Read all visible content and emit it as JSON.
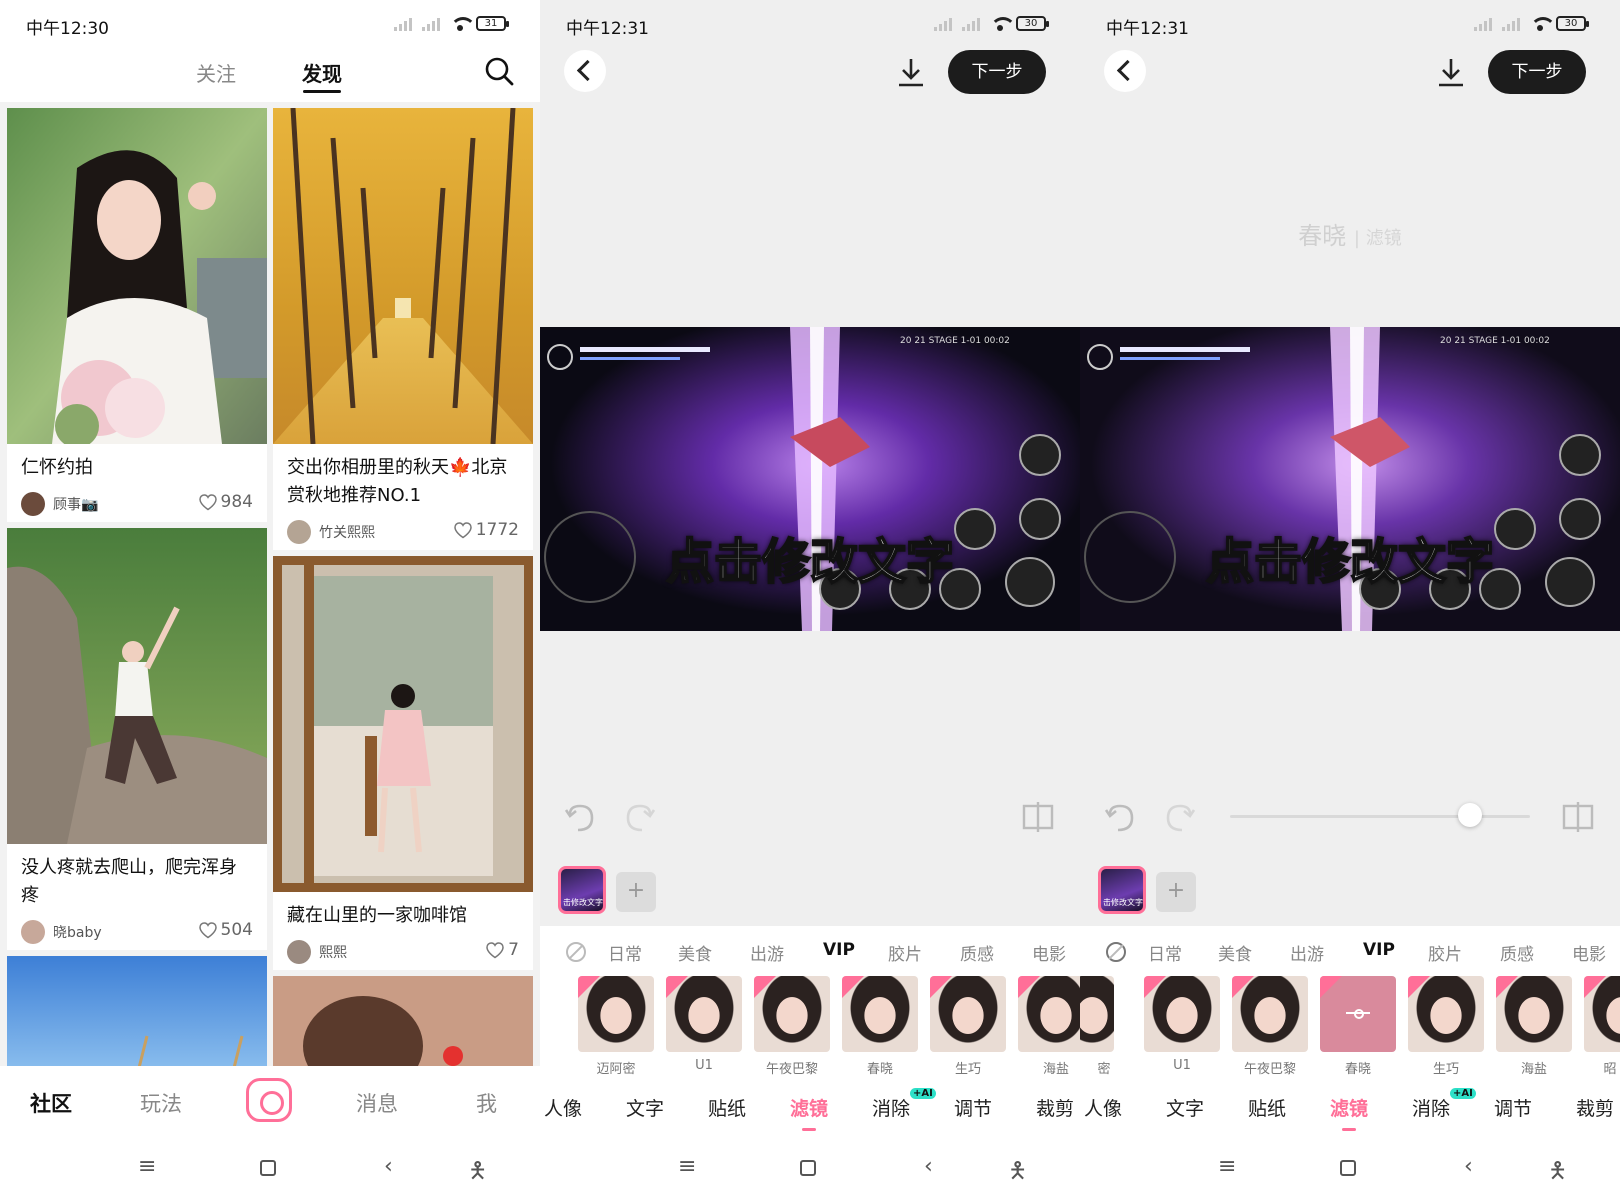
{
  "status": {
    "p1_time": "中午12:30",
    "p2_time": "中午12:31",
    "p3_time": "中午12:31",
    "p1_battery": "31",
    "p2_battery": "30",
    "p3_battery": "30"
  },
  "community": {
    "tabs": [
      "关注",
      "发现"
    ],
    "active_tab": "发现",
    "cards": [
      {
        "title": "仁怀约拍",
        "author": "顾事📷",
        "likes": "984"
      },
      {
        "title": "没人疼就去爬山，爬完浑身疼",
        "author": "晓baby",
        "likes": "504"
      },
      {
        "title": "交出你相册里的秋天🍁北京赏秋地推荐NO.1",
        "author": "竹关熙熙",
        "likes": "1772"
      },
      {
        "title": "藏在山里的一家咖啡馆",
        "author": "熙熙",
        "likes": "7"
      }
    ],
    "nav": [
      "社区",
      "玩法",
      "消息",
      "我"
    ]
  },
  "editor": {
    "next_label": "下一步",
    "caption": "点击修改文字",
    "clip_caption": "击修改文字",
    "ghost_filter": "春晓",
    "ghost_sub": "| 滤镜",
    "categories": [
      "日常",
      "美食",
      "出游",
      "VIP",
      "胶片",
      "质感",
      "电影"
    ],
    "p2_filters": [
      "迈阿密",
      "U1",
      "午夜巴黎",
      "春晓",
      "生巧",
      "海盐"
    ],
    "p3_filters": [
      "密",
      "U1",
      "午夜巴黎",
      "春晓",
      "生巧",
      "海盐",
      "昭"
    ],
    "tools": [
      "人像",
      "文字",
      "贴纸",
      "滤镜",
      "消除",
      "调节",
      "裁剪"
    ],
    "active_tool": "滤镜",
    "ai_badge": "+AI",
    "slider_value": 0.8
  },
  "colors": {
    "accent": "#ff6f98",
    "next_button": "#1c1c1c",
    "ai_badge": "#2de0c8"
  }
}
